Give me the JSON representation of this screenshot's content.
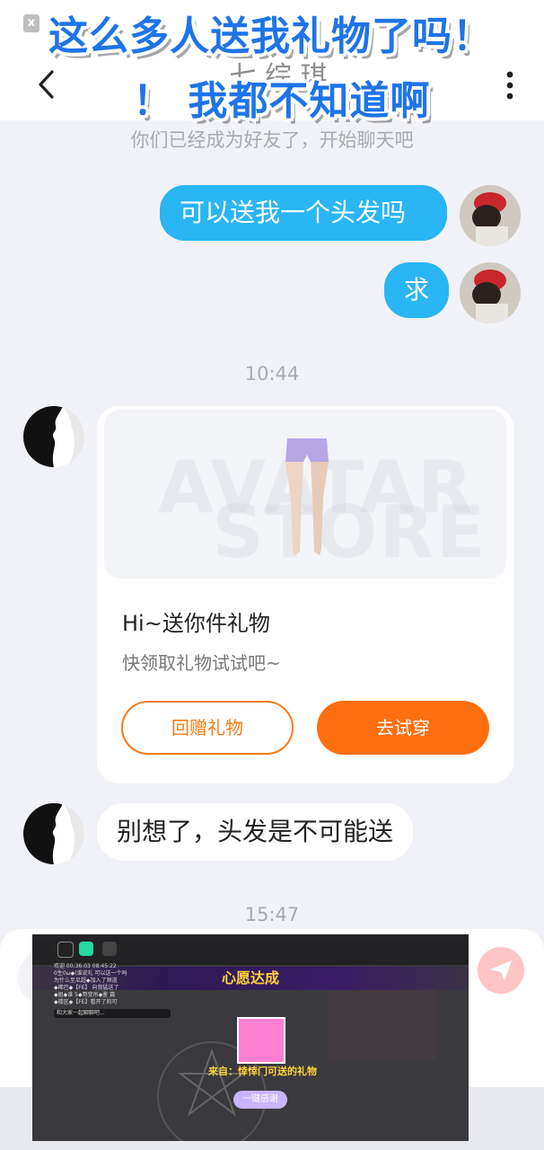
{
  "overlay": {
    "line1": "这么多人送我礼物了吗！",
    "line2": "！ 我都不知道啊"
  },
  "header": {
    "close_badge": "x",
    "title": "七 综 琪",
    "back_icon": "chevron-left-icon",
    "more_icon": "vertical-dots-icon"
  },
  "chat": {
    "system_notice": "你们已经成为好友了，开始聊天吧",
    "outgoing": [
      {
        "text": "可以送我一个头发吗"
      },
      {
        "text": "求"
      }
    ],
    "time1": "10:44",
    "gift_card": {
      "watermark_1": "AVATAR",
      "watermark_2": "STORE",
      "title": "Hi~送你件礼物",
      "subtitle": "快领取礼物试试吧~",
      "return_button": "回赠礼物",
      "try_button": "去试穿"
    },
    "incoming_text": "别想了，头发是不可能送",
    "time2": "15:47"
  },
  "input": {
    "send_icon": "send-icon"
  },
  "game_overlay": {
    "banner": "心愿达成",
    "from_text": "来自：悻悻门可送的礼物",
    "thanks_button": "一键感谢",
    "chat_lines": [
      "欢迎 00:36:03 08:45:22",
      "0生0ω◆(谁说礼 可以送一个吗",
      "为什么至瓜超◆加入了频道",
      "◆稀巴◆【FE】 向我猛送了",
      "◆姐◆谁 5◆哥变吊◆鉴 篇",
      "◆楼区◆【FE】看开了的可"
    ],
    "chat_input": "和大家一起聊聊吧..."
  },
  "colors": {
    "accent_blue": "#2ab5f5",
    "accent_orange": "#ff6f0f",
    "overlay_blue": "#1e74e8",
    "background": "#f1f2f7"
  }
}
